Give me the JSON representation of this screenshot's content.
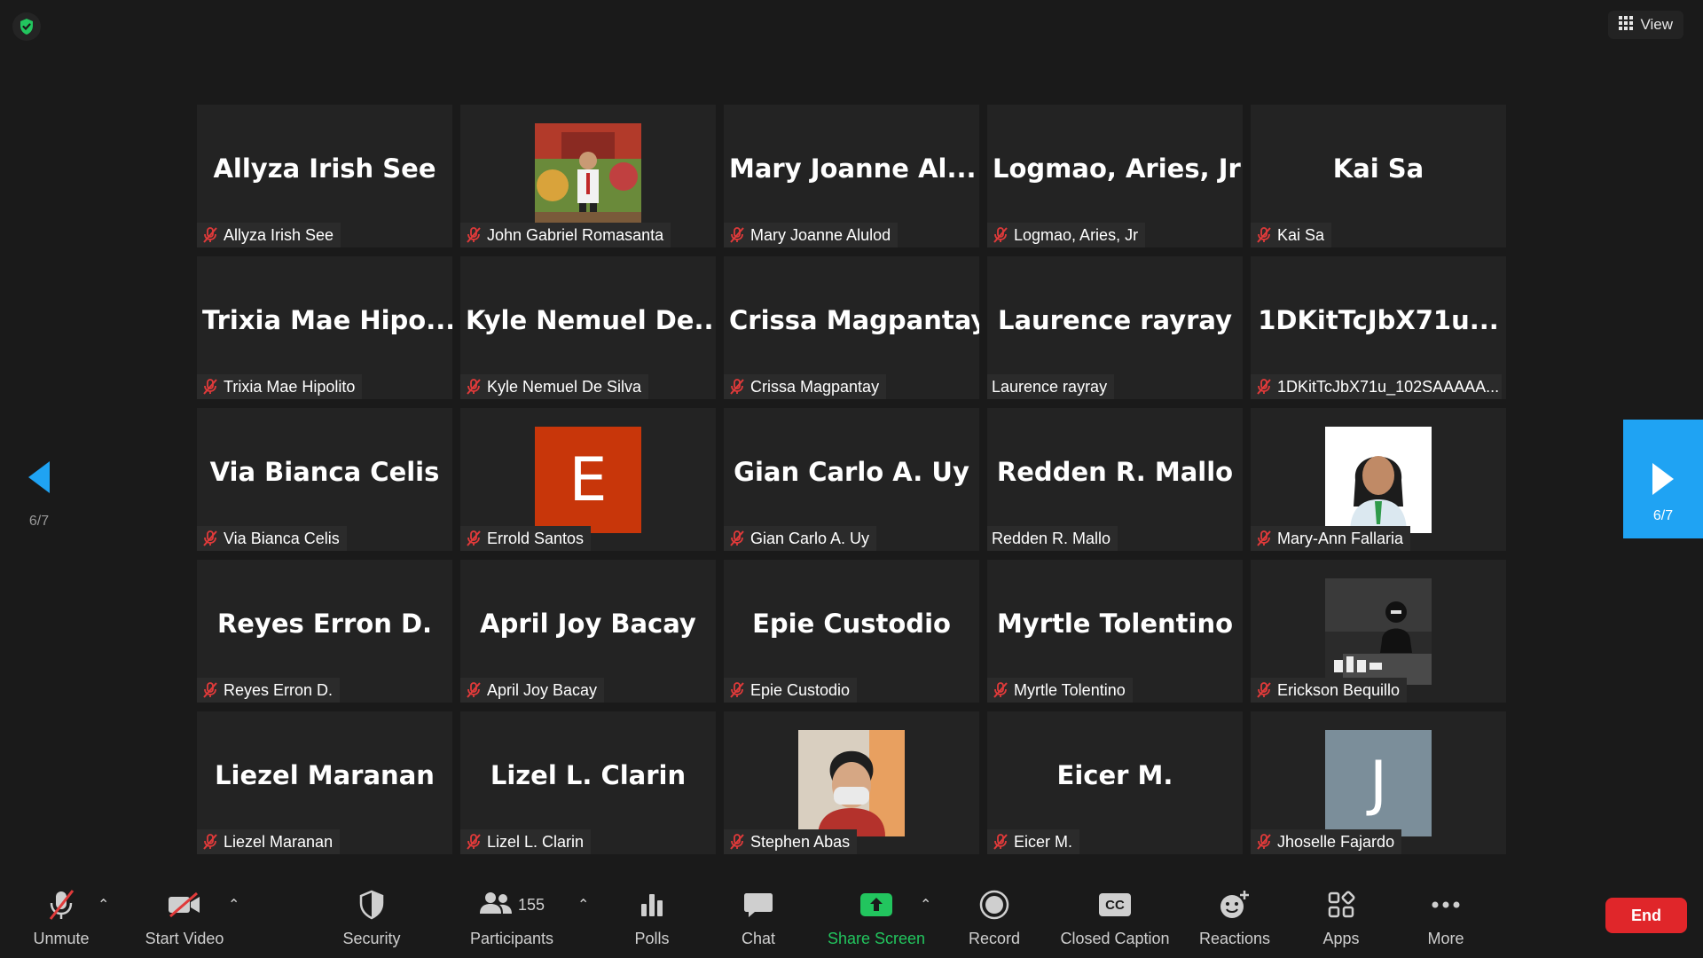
{
  "header": {
    "view_label": "View"
  },
  "pagination": {
    "label": "6/7"
  },
  "participants": [
    {
      "big": "Allyza Irish See",
      "tag": "Allyza Irish See",
      "muted": true,
      "avatar": "none"
    },
    {
      "big": "",
      "tag": "John Gabriel Romasanta",
      "muted": true,
      "avatar": "photo",
      "photo": "photo-outdoor-red"
    },
    {
      "big": "Mary Joanne Al...",
      "tag": "Mary Joanne Alulod",
      "muted": true,
      "avatar": "none"
    },
    {
      "big": "Logmao, Aries, Jr",
      "tag": "Logmao, Aries, Jr",
      "muted": true,
      "avatar": "none"
    },
    {
      "big": "Kai Sa",
      "tag": "Kai Sa",
      "muted": true,
      "avatar": "none"
    },
    {
      "big": "Trixia Mae Hipo...",
      "tag": "Trixia Mae Hipolito",
      "muted": true,
      "avatar": "none"
    },
    {
      "big": "Kyle Nemuel De...",
      "tag": "Kyle Nemuel De Silva",
      "muted": true,
      "avatar": "none"
    },
    {
      "big": "Crissa Magpantay",
      "tag": "Crissa Magpantay",
      "muted": true,
      "avatar": "none"
    },
    {
      "big": "Laurence rayray",
      "tag": "Laurence rayray",
      "muted": false,
      "avatar": "none"
    },
    {
      "big": "1DKitTcJbX71u...",
      "tag": "1DKitTcJbX71u_102SAAAAA...",
      "muted": true,
      "avatar": "none"
    },
    {
      "big": "Via Bianca Celis",
      "tag": "Via Bianca Celis",
      "muted": true,
      "avatar": "none"
    },
    {
      "big": "",
      "tag": "Errold Santos",
      "muted": true,
      "avatar": "letter",
      "letter": "E",
      "color": "#c8360a"
    },
    {
      "big": "Gian Carlo A. Uy",
      "tag": "Gian Carlo A. Uy",
      "muted": true,
      "avatar": "none"
    },
    {
      "big": "Redden R. Mallo",
      "tag": "Redden R. Mallo",
      "muted": false,
      "avatar": "none"
    },
    {
      "big": "",
      "tag": "Mary-Ann Fallaria",
      "muted": true,
      "avatar": "photo",
      "photo": "photo-portrait"
    },
    {
      "big": "Reyes Erron D.",
      "tag": "Reyes Erron D.",
      "muted": true,
      "avatar": "none"
    },
    {
      "big": "April Joy Bacay",
      "tag": "April Joy Bacay",
      "muted": true,
      "avatar": "none"
    },
    {
      "big": "Epie Custodio",
      "tag": "Epie Custodio",
      "muted": true,
      "avatar": "none"
    },
    {
      "big": "Myrtle Tolentino",
      "tag": "Myrtle Tolentino",
      "muted": true,
      "avatar": "none"
    },
    {
      "big": "",
      "tag": "Erickson Bequillo",
      "muted": true,
      "avatar": "photo",
      "photo": "photo-dark"
    },
    {
      "big": "Liezel Maranan",
      "tag": "Liezel Maranan",
      "muted": true,
      "avatar": "none"
    },
    {
      "big": "Lizel L. Clarin",
      "tag": "Lizel L. Clarin",
      "muted": true,
      "avatar": "none"
    },
    {
      "big": "",
      "tag": "Stephen Abas",
      "muted": true,
      "avatar": "photo",
      "photo": "photo-mask"
    },
    {
      "big": "Eicer M.",
      "tag": "Eicer M.",
      "muted": true,
      "avatar": "none"
    },
    {
      "big": "",
      "tag": "Jhoselle Fajardo",
      "muted": true,
      "avatar": "letter",
      "letter": "J",
      "color": "#7b8e9a"
    }
  ],
  "toolbar": {
    "unmute": "Unmute",
    "start_video": "Start Video",
    "security": "Security",
    "participants": "Participants",
    "participants_count": "155",
    "polls": "Polls",
    "chat": "Chat",
    "share_screen": "Share Screen",
    "record": "Record",
    "closed_caption": "Closed Caption",
    "cc_icon_text": "CC",
    "reactions": "Reactions",
    "apps": "Apps",
    "more": "More",
    "end": "End"
  },
  "colors": {
    "accent_blue": "#1fa3f3",
    "end_red": "#e0262a",
    "share_green": "#22c55e",
    "muted_red": "#e03a3a"
  }
}
